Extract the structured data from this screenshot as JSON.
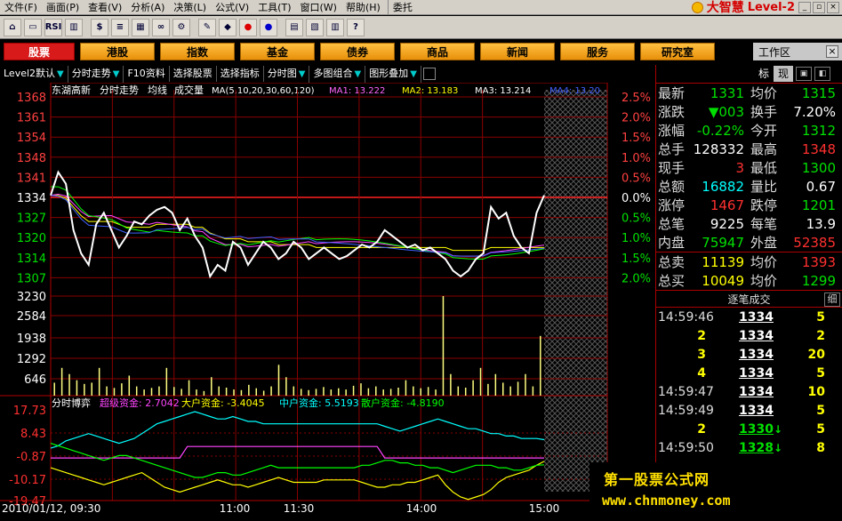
{
  "menu": {
    "items": [
      "文件(F)",
      "画面(P)",
      "查看(V)",
      "分析(A)",
      "决策(L)",
      "公式(V)",
      "工具(T)",
      "窗口(W)",
      "帮助(H)",
      "委托"
    ],
    "brand": "大智慧",
    "edition": "Level-2"
  },
  "toolbar": {
    "icons": [
      "home-icon",
      "folder-icon",
      "rsi-icon",
      "chart-icon",
      "dollar-icon",
      "list-icon",
      "grid-icon",
      "binoculars-icon",
      "settings-icon",
      "draw-icon",
      "diamond-icon",
      "red-mark-icon",
      "blue-mark-icon",
      "news-icon",
      "multi-icon",
      "book-icon",
      "help-cursor-icon"
    ],
    "rsi": "RSI",
    "f10": "F10",
    "dollar": "$"
  },
  "nav": {
    "tabs": [
      "股票",
      "港股",
      "指数",
      "基金",
      "债券",
      "商品",
      "新闻",
      "服务",
      "研究室"
    ],
    "active": 0,
    "workspace": "工作区"
  },
  "subtabs": [
    "Level2默认",
    "分时走势",
    "F10资料",
    "选择股票",
    "选择指标",
    "分时图",
    "多图组合",
    "图形叠加"
  ],
  "chart": {
    "header_name": "东湖高新",
    "header_type": "分时走势",
    "header_avg": "均线",
    "header_vol": "成交量",
    "ma_label": "MA(5,10,20,30,60,120)",
    "ma1": "MA1: 13.222",
    "ma2": "MA2: 13.183",
    "ma3": "MA3: 13.214",
    "ma4": "MA4: 13.20",
    "mid_label": "分时博弈",
    "fund_super": "超级资金: 2.7042",
    "fund_large": "大户资金: -3.4045",
    "fund_mid": "中户资金: 5.5193",
    "fund_small": "散户资金: -4.8190",
    "time_first": "2010/01/12, 09:30",
    "time_labels": [
      "11:00",
      "11:30",
      "14:00",
      "15:00"
    ],
    "price_ticks": [
      "1368",
      "1361",
      "1354",
      "1348",
      "1341",
      "1334",
      "1327",
      "1320",
      "1314",
      "1307"
    ],
    "pct_ticks": [
      "2.5%",
      "2.0%",
      "1.5%",
      "1.0%",
      "0.5%",
      "0.0%",
      "0.5%",
      "1.0%",
      "1.5%",
      "2.0%"
    ],
    "vol_ticks": [
      "3230",
      "2584",
      "1938",
      "1292",
      "646"
    ],
    "ind_ticks": [
      "17.73",
      "8.43",
      "-0.87",
      "-10.17",
      "-19.47"
    ]
  },
  "chart_data": {
    "type": "line",
    "title": "东湖高新 分时走势",
    "price_axis": {
      "min": 1300,
      "max": 1368,
      "prev_close": 1334
    },
    "price": [
      1334,
      1342,
      1338,
      1322,
      1314,
      1310,
      1324,
      1328,
      1322,
      1316,
      1320,
      1325,
      1324,
      1327,
      1329,
      1330,
      1328,
      1322,
      1326,
      1320,
      1316,
      1306,
      1310,
      1308,
      1318,
      1316,
      1310,
      1314,
      1318,
      1316,
      1312,
      1314,
      1318,
      1316,
      1312,
      1314,
      1316,
      1314,
      1312,
      1313,
      1315,
      1317,
      1316,
      1318,
      1322,
      1320,
      1318,
      1316,
      1317,
      1315,
      1316,
      1314,
      1312,
      1308,
      1306,
      1308,
      1312,
      1314,
      1330,
      1326,
      1328,
      1320,
      1316,
      1314,
      1328,
      1334
    ],
    "average": [
      1334,
      1334,
      1333,
      1330,
      1327,
      1325,
      1325,
      1325,
      1325,
      1324,
      1323,
      1323,
      1323,
      1323,
      1324,
      1324,
      1324,
      1324,
      1324,
      1323,
      1323,
      1321,
      1320,
      1319,
      1319,
      1319,
      1318,
      1318,
      1318,
      1318,
      1317,
      1317,
      1317,
      1317,
      1317,
      1316,
      1316,
      1316,
      1316,
      1316,
      1316,
      1316,
      1316,
      1316,
      1316,
      1316,
      1316,
      1316,
      1316,
      1316,
      1316,
      1316,
      1316,
      1315,
      1315,
      1315,
      1315,
      1315,
      1316,
      1316,
      1316,
      1316,
      1316,
      1316,
      1316,
      1316
    ],
    "volume_axis": {
      "max": 3230,
      "ticks": [
        3230,
        2584,
        1938,
        1292,
        646
      ]
    },
    "volume": [
      420,
      900,
      700,
      500,
      380,
      420,
      900,
      300,
      250,
      400,
      650,
      300,
      200,
      250,
      300,
      900,
      280,
      220,
      500,
      200,
      150,
      600,
      300,
      260,
      200,
      180,
      350,
      240,
      160,
      300,
      1000,
      600,
      300,
      220,
      180,
      220,
      280,
      200,
      240,
      200,
      320,
      400,
      240,
      300,
      200,
      220,
      260,
      500,
      300,
      240,
      280,
      200,
      3230,
      700,
      300,
      260,
      500,
      900,
      380,
      700,
      420,
      300,
      450,
      700,
      300,
      1938
    ],
    "indicator_axis": {
      "min": -19.47,
      "max": 17.73
    },
    "series": [
      {
        "name": "超级资金",
        "color": "#ff44ff",
        "values": [
          -2,
          -2,
          -2,
          -2,
          -2,
          -2,
          -2,
          -2,
          -2,
          -2,
          -2,
          -2,
          -2,
          -2,
          -2,
          -2,
          -2,
          -2,
          2.7,
          2.7,
          2.7,
          2.7,
          2.7,
          2.7,
          2.7,
          2.7,
          2.7,
          2.7,
          2.7,
          2.7,
          2.7,
          2.7,
          2.7,
          2.7,
          2.7,
          2.7,
          2.7,
          2.7,
          2.7,
          2.7,
          2.7,
          2.7,
          2.7,
          2.7,
          -2,
          -2,
          -2,
          -2,
          -2,
          -2,
          -2,
          -2,
          -2,
          -2,
          -2,
          -2,
          -2,
          -2,
          -2,
          -2,
          -2,
          -2,
          -2,
          -2,
          -2,
          -2
        ]
      },
      {
        "name": "大户资金",
        "color": "#ffff00",
        "values": [
          -6,
          -7,
          -8,
          -9,
          -10,
          -11,
          -12,
          -13,
          -12,
          -11,
          -10,
          -9,
          -8,
          -10,
          -12,
          -14,
          -15,
          -16,
          -15,
          -14,
          -13,
          -12,
          -11,
          -12,
          -13,
          -13,
          -14,
          -13,
          -12,
          -11,
          -10,
          -11,
          -12,
          -12,
          -12,
          -12,
          -11,
          -11,
          -11,
          -11,
          -11,
          -12,
          -13,
          -14,
          -14,
          -13,
          -13,
          -12,
          -12,
          -11,
          -10,
          -9,
          -13,
          -16,
          -18,
          -19,
          -18,
          -17,
          -15,
          -12,
          -10,
          -9,
          -8,
          -7,
          -5,
          -3.4
        ]
      },
      {
        "name": "中户资金",
        "color": "#00ffff",
        "values": [
          2,
          3,
          5,
          6,
          7,
          8,
          7,
          6,
          5,
          4,
          5,
          6,
          8,
          10,
          12,
          13,
          14,
          15,
          16,
          17,
          16,
          15,
          14,
          14,
          15,
          14,
          13,
          13,
          12,
          12,
          12,
          12,
          12,
          12,
          12,
          12,
          12,
          12,
          12,
          12,
          12,
          12,
          12,
          12,
          11,
          10,
          9,
          10,
          11,
          12,
          13,
          14,
          13,
          12,
          11,
          10,
          10,
          9,
          8,
          8,
          7,
          7,
          6,
          6,
          6,
          5.5
        ]
      },
      {
        "name": "散户资金",
        "color": "#00ff00",
        "values": [
          4,
          3,
          2,
          1,
          0,
          -1,
          -2,
          -3,
          -2,
          -1,
          -1,
          -2,
          -3,
          -4,
          -5,
          -6,
          -7,
          -8,
          -9,
          -10,
          -10,
          -9,
          -8,
          -8,
          -9,
          -9,
          -8,
          -7,
          -6,
          -5,
          -6,
          -6,
          -6,
          -6,
          -6,
          -6,
          -6,
          -6,
          -6,
          -6,
          -6,
          -5,
          -5,
          -4,
          -3,
          -3,
          -4,
          -4,
          -5,
          -5,
          -6,
          -6,
          -7,
          -8,
          -7,
          -6,
          -5,
          -5,
          -5,
          -6,
          -6,
          -7,
          -7,
          -6,
          -5,
          -4.8
        ]
      }
    ]
  },
  "quote": {
    "rows": [
      {
        "l1": "最新",
        "v1": "1331",
        "c1": "dn",
        "l2": "均价",
        "v2": "1315",
        "c2": "dn"
      },
      {
        "l1": "涨跌",
        "v1": "▼003",
        "c1": "dn",
        "l2": "换手",
        "v2": "7.20%",
        "c2": "wh"
      },
      {
        "l1": "涨幅",
        "v1": "-0.22%",
        "c1": "dn",
        "l2": "今开",
        "v2": "1312",
        "c2": "dn"
      },
      {
        "l1": "总手",
        "v1": "128332",
        "c1": "wh",
        "l2": "最高",
        "v2": "1348",
        "c2": "up"
      },
      {
        "l1": "现手",
        "v1": "3",
        "c1": "up",
        "l2": "最低",
        "v2": "1300",
        "c2": "dn"
      },
      {
        "l1": "总额",
        "v1": "16882",
        "c1": "cy",
        "l2": "量比",
        "v2": "0.67",
        "c2": "wh"
      },
      {
        "l1": "涨停",
        "v1": "1467",
        "c1": "up",
        "l2": "跌停",
        "v2": "1201",
        "c2": "dn"
      },
      {
        "l1": "总笔",
        "v1": "9225",
        "c1": "wh",
        "l2": "每笔",
        "v2": "13.9",
        "c2": "wh"
      },
      {
        "l1": "内盘",
        "v1": "75947",
        "c1": "dn",
        "l2": "外盘",
        "v2": "52385",
        "c2": "up"
      }
    ],
    "rows2": [
      {
        "l1": "总卖",
        "v1": "11139",
        "c1": "yl",
        "l2": "均价",
        "v2": "1393",
        "c2": "up"
      },
      {
        "l1": "总买",
        "v1": "10049",
        "c1": "yl",
        "l2": "均价",
        "v2": "1299",
        "c2": "dn"
      }
    ],
    "tab_a": "标",
    "tab_b": "现"
  },
  "ticks": {
    "title": "逐笔成交",
    "detail": "细",
    "rows": [
      {
        "time": "14:59:46",
        "price": "1334",
        "arrow": "",
        "qty": "5"
      },
      {
        "time": "2",
        "price": "1334",
        "arrow": "",
        "qty": "2"
      },
      {
        "time": "3",
        "price": "1334",
        "arrow": "",
        "qty": "20"
      },
      {
        "time": "4",
        "price": "1334",
        "arrow": "",
        "qty": "5"
      },
      {
        "time": "14:59:47",
        "price": "1334",
        "arrow": "",
        "qty": "10"
      },
      {
        "time": "14:59:49",
        "price": "1334",
        "arrow": "",
        "qty": "5"
      },
      {
        "time": "2",
        "price": "1330",
        "arrow": "↓",
        "qty": "5"
      },
      {
        "time": "14:59:50",
        "price": "1328",
        "arrow": "↓",
        "qty": "8"
      }
    ]
  },
  "watermark": {
    "line1": "第一股票公式网",
    "line2": "www.chnmoney.com"
  }
}
